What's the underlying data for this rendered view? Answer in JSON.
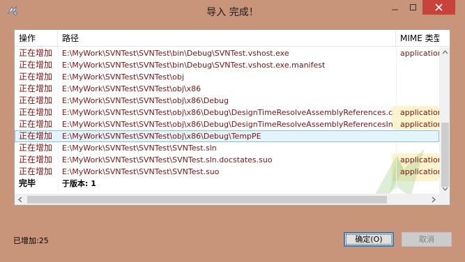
{
  "window": {
    "title": "导入 完成！",
    "close_icon": "close-icon",
    "accent_close": "#c7433b"
  },
  "list": {
    "columns": {
      "op": "操作",
      "path": "路径",
      "mime": "MIME 类型"
    },
    "rows": [
      {
        "op": "正在增加",
        "path": "E:\\MyWork\\SVNTest\\SVNTest\\bin\\Debug\\SVNTest.vshost.exe",
        "mime": "application/o"
      },
      {
        "op": "正在增加",
        "path": "E:\\MyWork\\SVNTest\\SVNTest\\bin\\Debug\\SVNTest.vshost.exe.manifest",
        "mime": ""
      },
      {
        "op": "正在增加",
        "path": "E:\\MyWork\\SVNTest\\SVNTest\\obj",
        "mime": ""
      },
      {
        "op": "正在增加",
        "path": "E:\\MyWork\\SVNTest\\SVNTest\\obj\\x86",
        "mime": ""
      },
      {
        "op": "正在增加",
        "path": "E:\\MyWork\\SVNTest\\SVNTest\\obj\\x86\\Debug",
        "mime": ""
      },
      {
        "op": "正在增加",
        "path": "E:\\MyWork\\SVNTest\\SVNTest\\obj\\x86\\Debug\\DesignTimeResolveAssemblyReferences.cache",
        "mime": "application/o"
      },
      {
        "op": "正在增加",
        "path": "E:\\MyWork\\SVNTest\\SVNTest\\obj\\x86\\Debug\\DesignTimeResolveAssemblyReferencesInput.cache",
        "mime": "application/o"
      },
      {
        "op": "正在增加",
        "path": "E:\\MyWork\\SVNTest\\SVNTest\\obj\\x86\\Debug\\TempPE",
        "mime": ""
      },
      {
        "op": "正在增加",
        "path": "E:\\MyWork\\SVNTest\\SVNTest\\SVNTest.sln",
        "mime": ""
      },
      {
        "op": "正在增加",
        "path": "E:\\MyWork\\SVNTest\\SVNTest\\SVNTest.sln.docstates.suo",
        "mime": "application/o"
      },
      {
        "op": "正在增加",
        "path": "E:\\MyWork\\SVNTest\\SVNTest\\SVNTest.suo",
        "mime": "application/o"
      },
      {
        "op": "完毕",
        "path": "于版本: 1",
        "mime": ""
      }
    ],
    "selected_row": 7
  },
  "footer": {
    "summary": "已增加:25",
    "ok_label": "确定(O)",
    "cancel_label": "取消"
  }
}
